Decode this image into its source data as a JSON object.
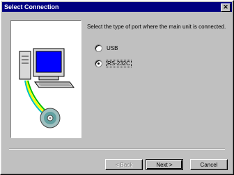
{
  "window": {
    "title": "Select Connection",
    "close_glyph": "✕"
  },
  "content": {
    "instruction": "Select the type of port where the main unit is connected.",
    "options": [
      {
        "label": "USB",
        "checked": false
      },
      {
        "label": "RS-232C",
        "checked": true
      }
    ]
  },
  "buttons": {
    "back": "< Back",
    "next": "Next >",
    "cancel": "Cancel"
  }
}
